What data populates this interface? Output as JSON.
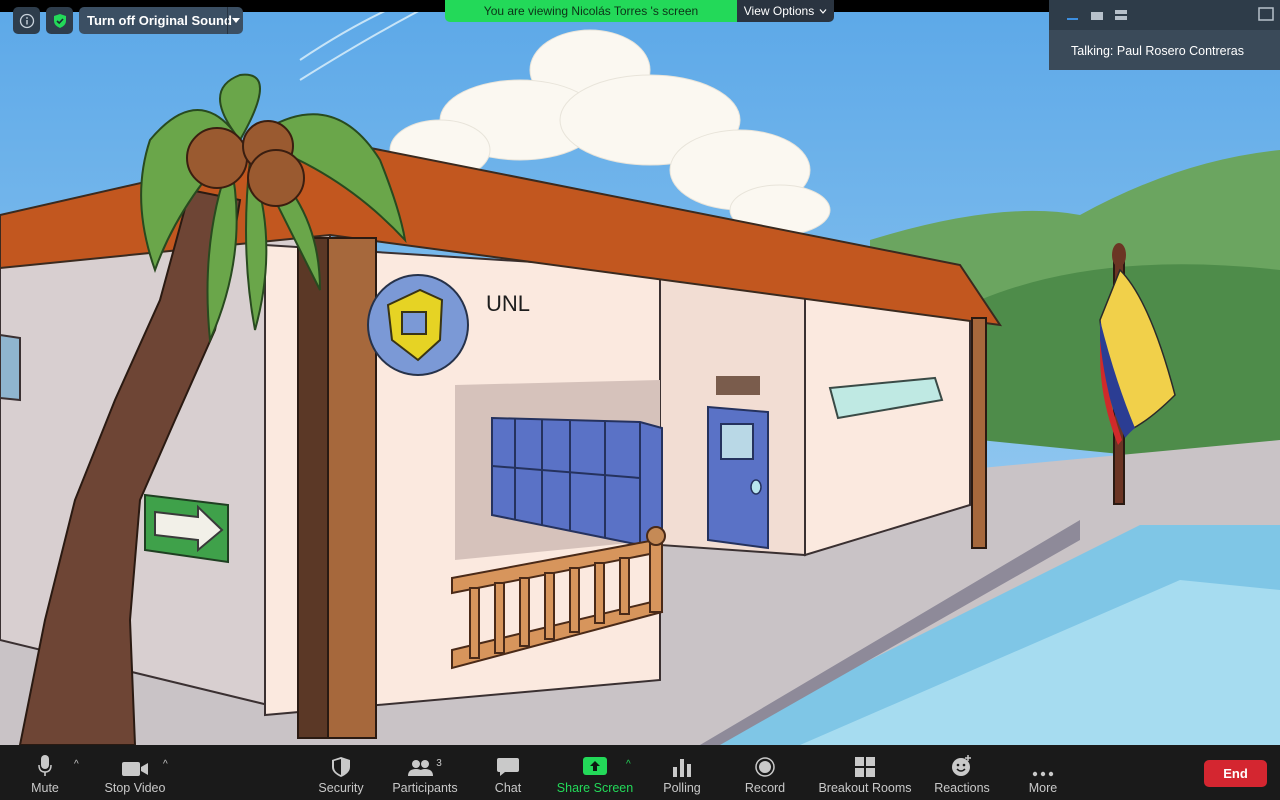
{
  "window": {
    "top_left": {
      "sound_button": "Turn off Original Sound"
    },
    "share_banner": {
      "text": "You are viewing Nicolás Torres 's screen",
      "view_options": "View Options"
    },
    "speaker_panel": {
      "talking": "Talking: Paul Rosero Contreras"
    }
  },
  "scene": {
    "building_sign": "UNL"
  },
  "toolbar": {
    "mute": "Mute",
    "stop_video": "Stop Video",
    "security": "Security",
    "participants": "Participants",
    "participants_count": "3",
    "chat": "Chat",
    "share_screen": "Share Screen",
    "polling": "Polling",
    "record": "Record",
    "breakout_rooms": "Breakout Rooms",
    "reactions": "Reactions",
    "more": "More",
    "end": "End"
  },
  "colors": {
    "share_green": "#23d959",
    "end_red": "#d42630",
    "toolbar_bg": "#1a1a1a"
  }
}
